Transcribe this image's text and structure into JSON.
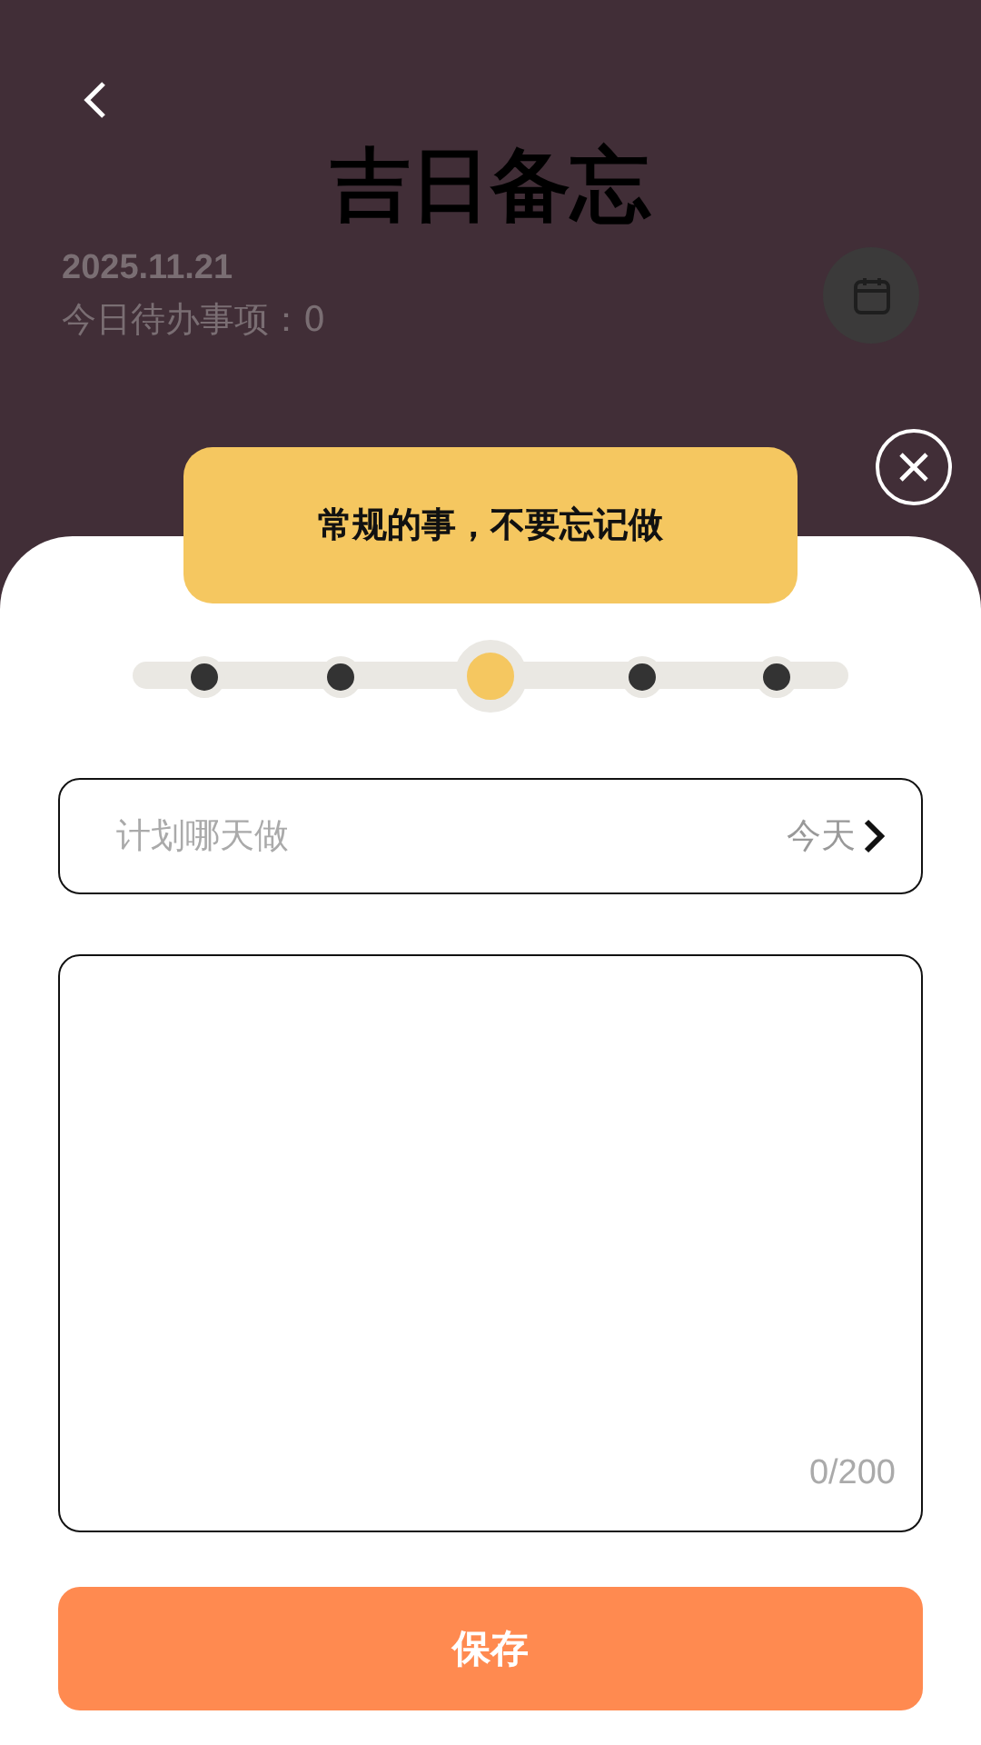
{
  "header": {
    "title": "吉日备忘",
    "date": "2025.11.21",
    "todo_count": "今日待办事项：0"
  },
  "tooltip": {
    "text": "常规的事，不要忘记做"
  },
  "stops": [
    {
      "selected": false
    },
    {
      "selected": false
    },
    {
      "selected": true
    },
    {
      "selected": false
    },
    {
      "selected": false
    }
  ],
  "date_field": {
    "placeholder": "计划哪天做",
    "value": "今天"
  },
  "note": {
    "counter": "0/200"
  },
  "save_button": {
    "label": "保存"
  }
}
